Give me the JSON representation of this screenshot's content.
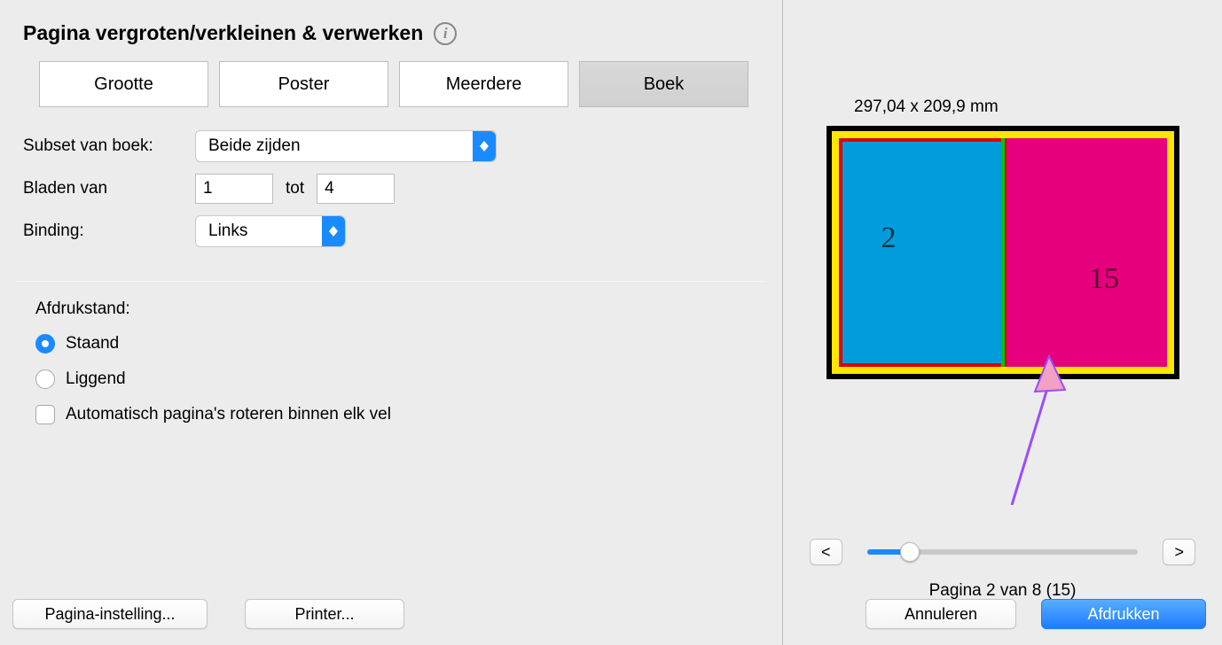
{
  "left": {
    "title": "Pagina vergroten/verkleinen & verwerken",
    "tabs": {
      "size": "Grootte",
      "poster": "Poster",
      "multiple": "Meerdere",
      "booklet": "Boek"
    },
    "subset_label": "Subset van boek:",
    "subset_value": "Beide zijden",
    "sheets_label": "Bladen van",
    "sheets_from": "1",
    "sheets_to_label": "tot",
    "sheets_to": "4",
    "binding_label": "Binding:",
    "binding_value": "Links",
    "orientation_label": "Afdrukstand:",
    "orientation_portrait": "Staand",
    "orientation_landscape": "Liggend",
    "auto_rotate": "Automatisch pagina's roteren binnen elk vel"
  },
  "footer_buttons": {
    "page_setup": "Pagina-instelling...",
    "printer": "Printer...",
    "cancel": "Annuleren",
    "print": "Afdrukken"
  },
  "preview": {
    "dimensions": "297,04 x 209,9 mm",
    "left_page_num": "2",
    "right_page_num": "15",
    "page_status": "Pagina 2 van 8 (15)"
  }
}
